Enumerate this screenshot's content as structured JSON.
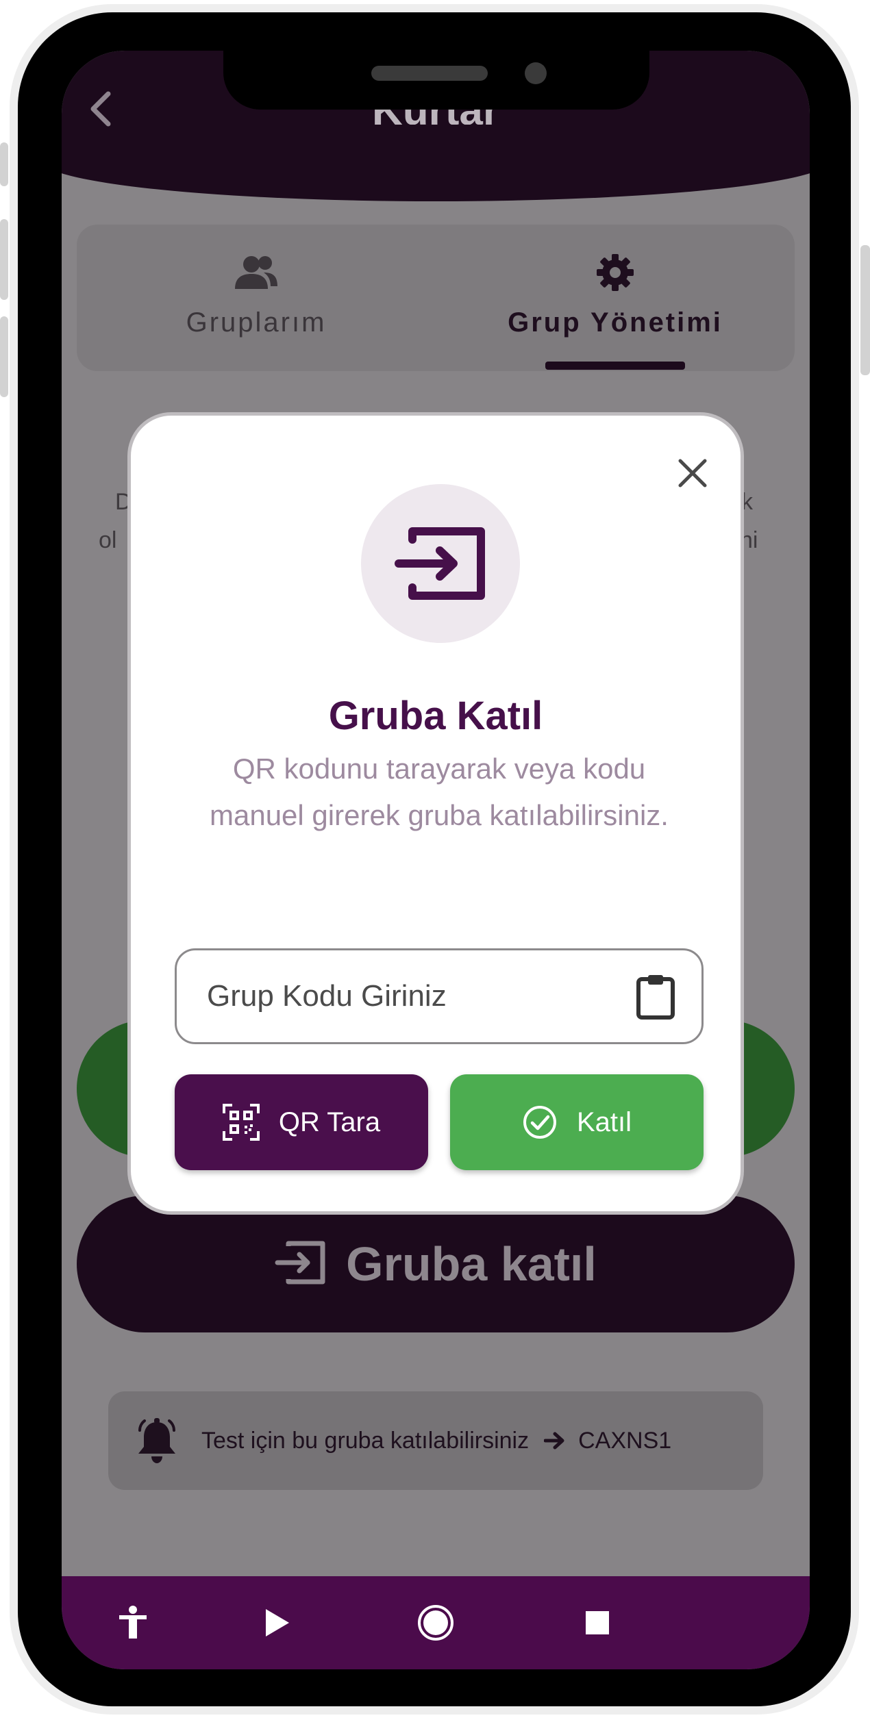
{
  "app": {
    "title": "Kurtar",
    "tabs": [
      {
        "label": "Gruplarım",
        "icon": "group-icon",
        "active": false
      },
      {
        "label": "Grup Yönetimi",
        "icon": "gear-icon",
        "active": true
      }
    ]
  },
  "background": {
    "join_button_label": "Gruba katıl",
    "hint_text": "Test için bu gruba katılabilirsiniz",
    "hint_code": "CAXNS1"
  },
  "dialog": {
    "title": "Gruba Katıl",
    "description": "QR kodunu tarayarak veya kodu manuel girerek gruba katılabilirsiniz.",
    "code_input": {
      "placeholder": "Grup Kodu Giriniz",
      "value": ""
    },
    "qr_button_label": "QR Tara",
    "join_button_label": "Katıl"
  },
  "navbar": {
    "items": [
      "accessibility-icon",
      "play-icon",
      "home-circle-icon",
      "stop-icon"
    ]
  },
  "colors": {
    "primary": "#4a0f4c",
    "success": "#4cad50",
    "appbar": "#1c0a1c",
    "navbar": "#4b0b4b"
  }
}
